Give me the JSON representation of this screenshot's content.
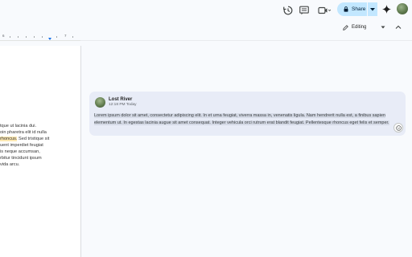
{
  "topbar": {
    "share_label": "Share",
    "icons": [
      "history-icon",
      "comment-icon",
      "meet-icon",
      "share-dropdown-icon",
      "gemini-icon",
      "account-avatar"
    ]
  },
  "toolbar": {
    "mode_label": "Editing"
  },
  "ruler": {
    "numbers": [
      "6",
      "7"
    ]
  },
  "document": {
    "lines": [
      {
        "text": "tque ut lacinia dui.",
        "highlighted": false
      },
      {
        "text": "oin pharetra elit id nulla",
        "highlighted": false
      },
      {
        "text": "rhoncus.",
        "highlighted": true,
        "rest": " Sed tristique sit"
      },
      {
        "text": "uent imperdiet feugiat",
        "highlighted": false
      },
      {
        "text": "is neque accumsan,",
        "highlighted": false
      },
      {
        "text": "rbitur tincidunt ipsum",
        "highlighted": false
      },
      {
        "text": "vida arcu.",
        "highlighted": false
      }
    ]
  },
  "comment": {
    "author": "Lost River",
    "time": "12:18 PM Today",
    "body": "Lorem ipsum dolor sit amet, consectetur adipiscing elit. In et urna feugiat, viverra massa in, venenatis ligula. Nam hendrerit nulla est, a finibus sapien elementum ut. In egestas lacinia augue sit amet consequat. Integer vehicula orci rutrum erat blandit feugiat. Pellentesque rhoncus eget felis et semper."
  },
  "colors": {
    "accent": "#c2e7ff",
    "highlight": "#fce8b2",
    "comment_bg": "#e8ecf7"
  }
}
